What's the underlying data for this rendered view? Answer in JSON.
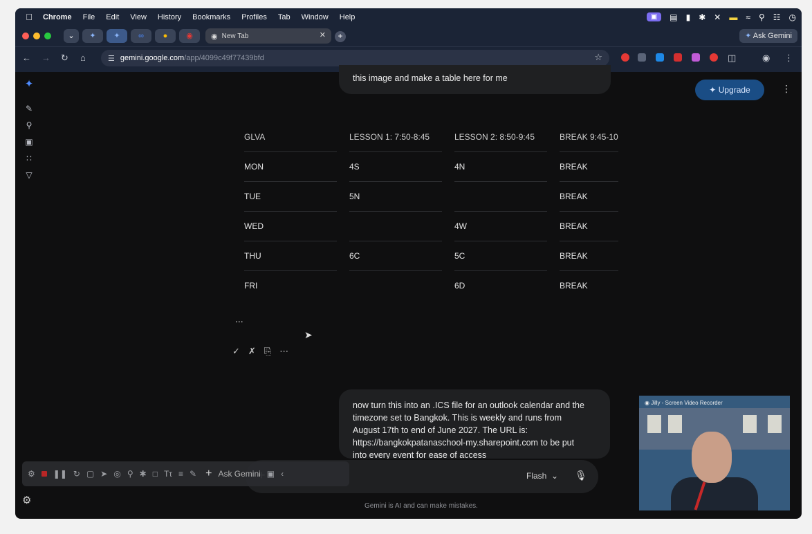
{
  "menubar": {
    "app": "Chrome",
    "items": [
      "File",
      "Edit",
      "View",
      "History",
      "Bookmarks",
      "Profiles",
      "Tab",
      "Window",
      "Help"
    ]
  },
  "tabs": {
    "active_title": "New Tab",
    "ask_gemini": "Ask Gemini"
  },
  "omnibox": {
    "host": "gemini.google.com",
    "path": "/app/4099c49f77439bfd"
  },
  "chat": {
    "prev_prompt_tail": "this image and make a table here for me",
    "upgrade_label": "Upgrade",
    "table": {
      "headers": [
        "GLVA",
        "LESSON 1: 7:50-8:45",
        "LESSON 2: 8:50-9:45",
        "BREAK 9:45-10"
      ],
      "rows": [
        [
          "MON",
          "4S",
          "4N",
          "BREAK"
        ],
        [
          "TUE",
          "5N",
          "",
          "BREAK"
        ],
        [
          "WED",
          "",
          "4W",
          "BREAK"
        ],
        [
          "THU",
          "6C",
          "5C",
          "BREAK"
        ],
        [
          "FRI",
          "",
          "6D",
          "BREAK"
        ]
      ]
    },
    "more_dots": "...",
    "new_prompt_lines": [
      "now turn this into an .ICS file for an outlook calendar and the",
      "timezone set to Bangkok. This is weekly and runs from",
      "August 17th to end of June 2027. The URL is:",
      "https://bangkokpatanaschool-my.sharepoint.com to be put",
      "into every event for ease of access"
    ]
  },
  "input": {
    "placeholder": "Ask Gemini",
    "mode": "Flash"
  },
  "disclaimer": "Gemini is AI and can make mistakes.",
  "webcam": {
    "label": "Jilly - Screen Video Recorder"
  }
}
